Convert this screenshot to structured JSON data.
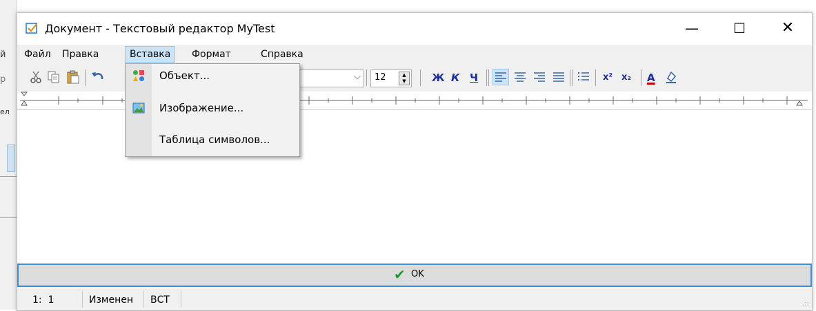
{
  "background": {
    "menu_fragment": "й",
    "toolbar_fragment": "р",
    "ruler_fragment": "ел"
  },
  "window": {
    "title": "Документ - Текстовый редактор MyTest",
    "controls": {
      "minimize": "—",
      "maximize": "☐",
      "close": "✕"
    }
  },
  "menu": {
    "items": [
      {
        "label": "Файл"
      },
      {
        "label": "Правка"
      },
      {
        "label": "Вставка",
        "active": true
      },
      {
        "label": "Формат"
      },
      {
        "label": "Справка"
      }
    ]
  },
  "toolbar": {
    "font_size": "12",
    "bold": "Ж",
    "italic": "К",
    "underline": "Ч",
    "superscript": "x²",
    "subscript": "x₂",
    "font_color_glyph": "A",
    "icons": [
      "cut-icon",
      "copy-icon",
      "paste-icon",
      "undo-icon",
      "font-dropdown-icon",
      "align-left-icon",
      "align-center-icon",
      "align-right-icon",
      "justify-icon",
      "bullet-list-icon",
      "font-color-icon",
      "highlight-icon"
    ]
  },
  "insert_menu": {
    "items": [
      {
        "label": "Объект...",
        "icon": "object-icon"
      },
      {
        "label": "Изображение...",
        "icon": "image-icon"
      },
      {
        "label": "Таблица символов...",
        "icon": ""
      }
    ]
  },
  "ok_button": {
    "label": "OK"
  },
  "status": {
    "position": "1:  1",
    "modified": "Изменен",
    "mode": "ВСТ"
  },
  "colors": {
    "accent": "#3c8ddc",
    "menu_highlight": "#cce4f7",
    "format_blue": "#1e2f9c",
    "font_color_bar": "#c00000"
  }
}
